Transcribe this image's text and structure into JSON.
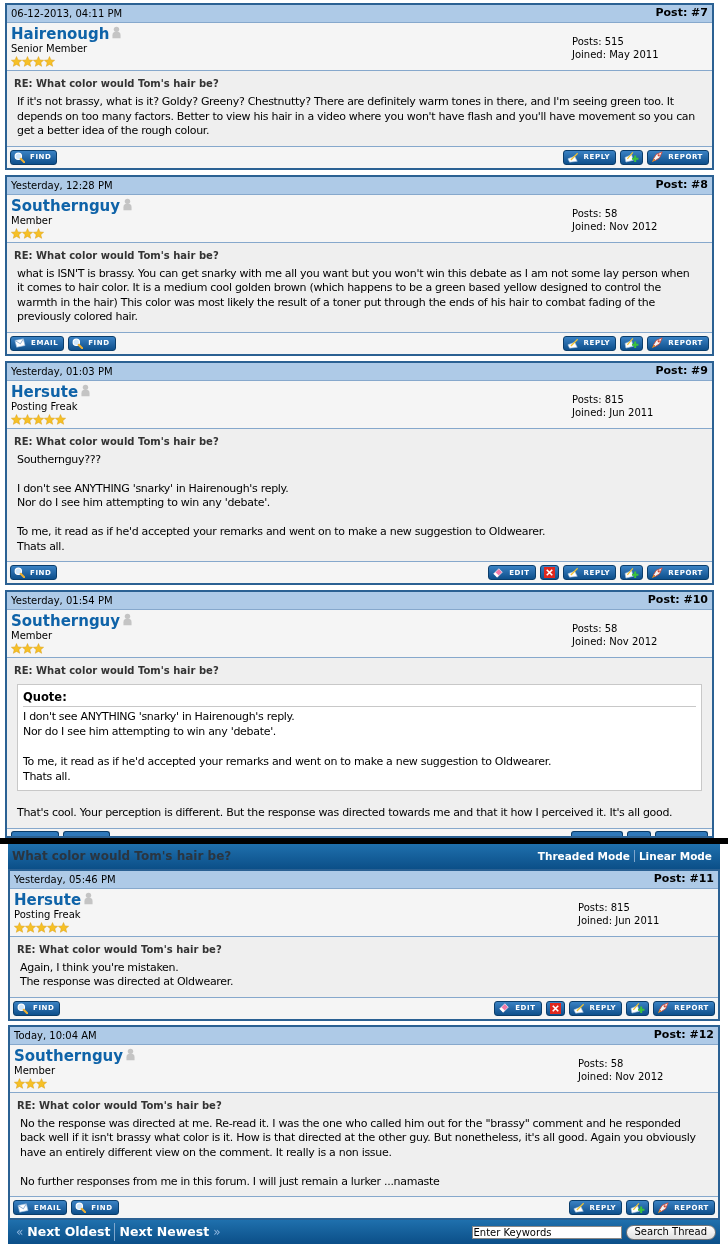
{
  "posts": [
    {
      "date": "06-12-2013, 04:11 PM",
      "number": "Post: #7",
      "author": "Hairenough",
      "online": false,
      "rank": "Senior Member",
      "stars": 4,
      "post_count": "Posts: 515",
      "joined": "Joined: May 2011",
      "subject": "RE: What color would Tom's hair be?",
      "message": "If it's not brassy, what is it? Goldy? Greeny? Chestnutty? There are definitely warm tones in there, and I'm seeing green too. It depends on too many factors. Better to view his hair in a video where you won't have flash and you'll have movement so you can get a better idea of the rough colour.",
      "buttons_left": [
        {
          "kind": "find",
          "label": "FIND"
        }
      ],
      "buttons_right": [
        {
          "kind": "reply",
          "label": "REPLY"
        },
        {
          "kind": "multiquote"
        },
        {
          "kind": "report",
          "label": "REPORT"
        }
      ]
    },
    {
      "date": "Yesterday, 12:28 PM",
      "number": "Post: #8",
      "author": "Southernguy",
      "online": false,
      "rank": "Member",
      "stars": 3,
      "post_count": "Posts: 58",
      "joined": "Joined: Nov 2012",
      "subject": "RE: What color would Tom's hair be?",
      "message": "what is ISN'T is brassy. You can get snarky with me all you want but you won't win this debate as I am not some lay person when it comes to hair color. It is a medium cool golden brown (which happens to be a green based yellow designed to control the warmth in the hair) This color was most likely the result of a toner put through the ends of his hair to combat fading of the previously colored hair.",
      "buttons_left": [
        {
          "kind": "email",
          "label": "EMAIL"
        },
        {
          "kind": "find",
          "label": "FIND"
        }
      ],
      "buttons_right": [
        {
          "kind": "reply",
          "label": "REPLY"
        },
        {
          "kind": "multiquote"
        },
        {
          "kind": "report",
          "label": "REPORT"
        }
      ]
    },
    {
      "date": "Yesterday, 01:03 PM",
      "number": "Post: #9",
      "author": "Hersute",
      "online": false,
      "rank": "Posting Freak",
      "stars": 5,
      "post_count": "Posts: 815",
      "joined": "Joined: Jun 2011",
      "subject": "RE: What color would Tom's hair be?",
      "message": "Southernguy???\n\nI don't see ANYTHING 'snarky' in Hairenough's reply.\nNor do I see him attempting to win any 'debate'.\n\nTo me, it read as if he'd accepted your remarks and went on to make a new suggestion to Oldwearer.\nThats all.",
      "buttons_left": [
        {
          "kind": "find",
          "label": "FIND"
        }
      ],
      "buttons_right": [
        {
          "kind": "edit",
          "label": "EDIT"
        },
        {
          "kind": "delete"
        },
        {
          "kind": "reply",
          "label": "REPLY"
        },
        {
          "kind": "multiquote"
        },
        {
          "kind": "report",
          "label": "REPORT"
        }
      ]
    },
    {
      "date": "Yesterday, 01:54 PM",
      "number": "Post: #10",
      "author": "Southernguy",
      "online": false,
      "rank": "Member",
      "stars": 3,
      "post_count": "Posts: 58",
      "joined": "Joined: Nov 2012",
      "subject": "RE: What color would Tom's hair be?",
      "quote": {
        "title": "Quote:",
        "text": "I don't see ANYTHING 'snarky' in Hairenough's reply.\nNor do I see him attempting to win any 'debate'.\n\nTo me, it read as if he'd accepted your remarks and went on to make a new suggestion to Oldwearer.\nThats all."
      },
      "message": "That's cool. Your perception is different. But the response was directed towards me and that it how I perceived it. It's all good.",
      "cut_off": true,
      "buttons_left": [
        {
          "kind": "email"
        },
        {
          "kind": "find"
        }
      ],
      "buttons_right": [
        {
          "kind": "reply"
        },
        {
          "kind": "multiquote"
        },
        {
          "kind": "report"
        }
      ]
    }
  ],
  "thread_bar": {
    "title": "What color would Tom's hair be?",
    "modes": [
      "Threaded Mode",
      "Linear Mode"
    ]
  },
  "posts_continued": [
    {
      "date": "Yesterday, 05:46 PM",
      "number": "Post: #11",
      "author": "Hersute",
      "online": false,
      "rank": "Posting Freak",
      "stars": 5,
      "post_count": "Posts: 815",
      "joined": "Joined: Jun 2011",
      "subject": "RE: What color would Tom's hair be?",
      "message": "Again, I think you're mistaken.\nThe response was directed at Oldwearer.",
      "buttons_left": [
        {
          "kind": "find",
          "label": "FIND"
        }
      ],
      "buttons_right": [
        {
          "kind": "edit",
          "label": "EDIT"
        },
        {
          "kind": "delete"
        },
        {
          "kind": "reply",
          "label": "REPLY"
        },
        {
          "kind": "multiquote"
        },
        {
          "kind": "report",
          "label": "REPORT"
        }
      ]
    },
    {
      "date": "Today, 10:04 AM",
      "number": "Post: #12",
      "author": "Southernguy",
      "online": false,
      "rank": "Member",
      "stars": 3,
      "post_count": "Posts: 58",
      "joined": "Joined: Nov 2012",
      "subject": "RE: What color would Tom's hair be?",
      "message": "No the response was directed at me. Re-read it. I was the one who called him out for the \"brassy\" comment and he responded back well if it isn't brassy what color is it. How is that directed at the other guy. But nonetheless, it's all good. Again you obviously have an entirely different view on the comment. It really is a non issue.\n\nNo further responses from me in this forum. I will just remain a lurker ...namaste",
      "buttons_left": [
        {
          "kind": "email",
          "label": "EMAIL"
        },
        {
          "kind": "find",
          "label": "FIND"
        }
      ],
      "buttons_right": [
        {
          "kind": "reply",
          "label": "REPLY"
        },
        {
          "kind": "multiquote"
        },
        {
          "kind": "report",
          "label": "REPORT"
        }
      ]
    }
  ],
  "footer": {
    "links": [
      {
        "label": "Next Oldest",
        "arrow_before": "«"
      },
      {
        "label": "Next Newest",
        "arrow_after": "»"
      }
    ],
    "search": {
      "placeholder": "Enter Keywords",
      "button": "Search Thread"
    }
  }
}
